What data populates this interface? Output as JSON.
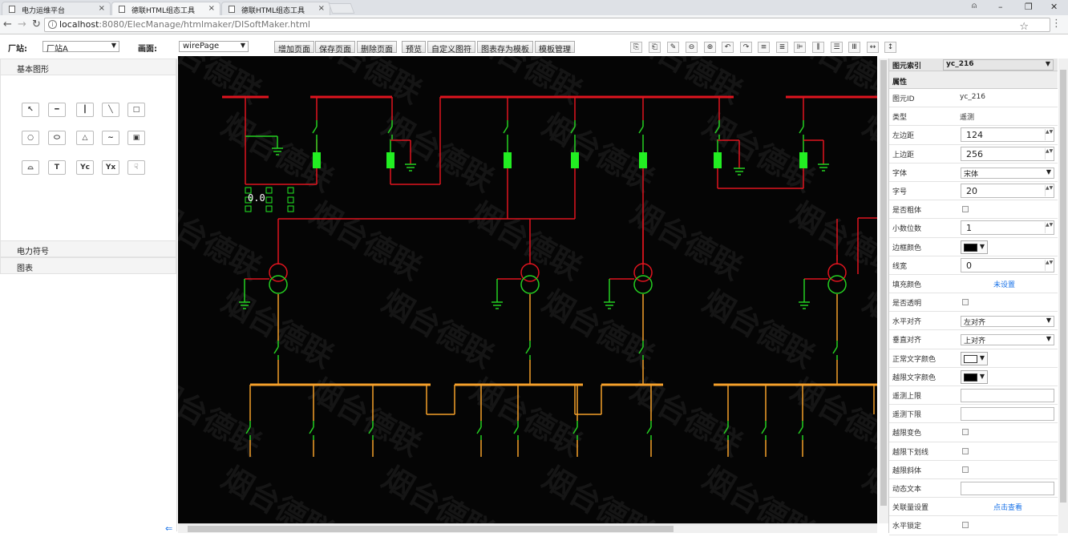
{
  "browser": {
    "tabs": [
      {
        "title": "电力运维平台"
      },
      {
        "title": "德联HTML组态工具"
      },
      {
        "title": "德联HTML组态工具"
      }
    ],
    "url_host": "localhost",
    "url_path": ":8080/ElecManage/htmlmaker/DISoftMaker.html",
    "win_min": "–",
    "win_max": "❐",
    "win_close": "✕"
  },
  "toolbar": {
    "station_label": "厂站:",
    "station_value": "厂站A",
    "page_label": "画面:",
    "page_value": "wirePage",
    "buttons": [
      "增加页面",
      "保存页面",
      "删除页面",
      "预览",
      "自定义图符",
      "图表存为模板",
      "模板管理"
    ],
    "icon_buttons": [
      "⎘",
      "⎗",
      "✎",
      "⊖",
      "⊕",
      "↶",
      "↷",
      "≡",
      "≣",
      "⊫",
      "⫼",
      "☰",
      "Ⅲ",
      "↔",
      "↕"
    ]
  },
  "left_panel": {
    "basic_shapes_title": "基本图形",
    "tools": [
      "↖",
      "━",
      "┃",
      "╲",
      "□",
      "○",
      "⬭",
      "△",
      "∼",
      "▣",
      "⌓",
      "T",
      "Yc",
      "Yx",
      "☟"
    ],
    "power_symbols_title": "电力符号",
    "charts_title": "图表"
  },
  "canvas": {
    "measurement_text": "0.0",
    "watermark": "烟台德联"
  },
  "properties": {
    "index_label": "图元索引",
    "index_value": "yc_216",
    "section_title": "属性",
    "rows": [
      {
        "key": "图元ID",
        "value": "yc_216"
      },
      {
        "key": "类型",
        "value": "遥测"
      },
      {
        "key": "左边距",
        "value": "124"
      },
      {
        "key": "上边距",
        "value": "256"
      },
      {
        "key": "字体",
        "value": "宋体"
      },
      {
        "key": "字号",
        "value": "20"
      },
      {
        "key": "是否粗体",
        "value": ""
      },
      {
        "key": "小数位数",
        "value": "1"
      },
      {
        "key": "边框颜色",
        "value": ""
      },
      {
        "key": "线宽",
        "value": "0"
      },
      {
        "key": "填充颜色",
        "value": "未设置"
      },
      {
        "key": "是否透明",
        "value": ""
      },
      {
        "key": "水平对齐",
        "value": "左对齐"
      },
      {
        "key": "垂直对齐",
        "value": "上对齐"
      },
      {
        "key": "正常文字颜色",
        "value": ""
      },
      {
        "key": "越限文字颜色",
        "value": ""
      },
      {
        "key": "遥测上限",
        "value": ""
      },
      {
        "key": "遥测下限",
        "value": ""
      },
      {
        "key": "越限变色",
        "value": ""
      },
      {
        "key": "越限下划线",
        "value": ""
      },
      {
        "key": "越限斜体",
        "value": ""
      },
      {
        "key": "动态文本",
        "value": ""
      },
      {
        "key": "关联量设置",
        "value": "点击查看"
      },
      {
        "key": "水平锁定",
        "value": ""
      }
    ]
  },
  "colors": {
    "bus_red": "#e0141e",
    "bus_orange": "#f5a02a",
    "switch_green": "#25d021",
    "breaker_green": "#22ee22",
    "canvas_bg": "#050505"
  }
}
